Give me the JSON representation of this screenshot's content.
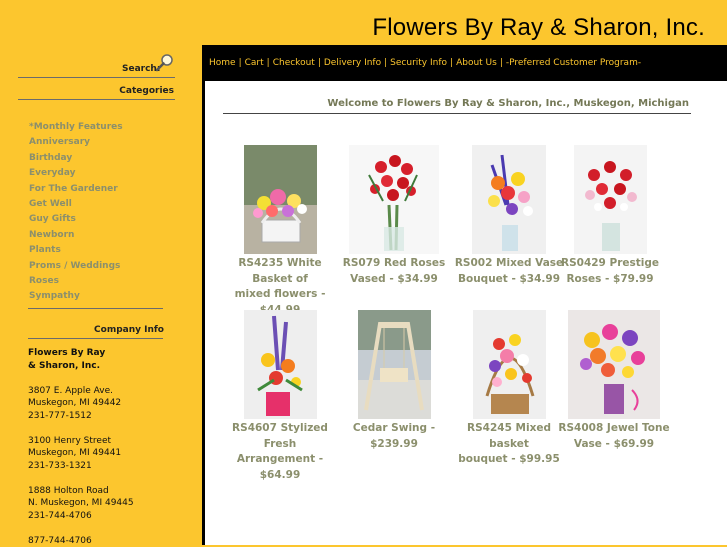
{
  "site": {
    "title": "Flowers By Ray & Sharon, Inc."
  },
  "sidebar": {
    "search_label": "Search:",
    "categories_title": "Categories",
    "categories": [
      "*Monthly Features",
      "Anniversary",
      "Birthday",
      "Everyday",
      "For The Gardener",
      "Get Well",
      "Guy Gifts",
      "Newborn",
      "Plants",
      "Proms / Weddings",
      "Roses",
      "Sympathy"
    ],
    "company_title": "Company Info",
    "company_name_1": "Flowers By Ray",
    "company_name_2": "& Sharon, Inc.",
    "locations": [
      {
        "street": "3807 E. Apple Ave.",
        "city": "Muskegon, MI 49442",
        "phone": "231-777-1512"
      },
      {
        "street": "3100 Henry Street",
        "city": "Muskegon, MI 49441",
        "phone": "231-733-1321"
      },
      {
        "street": "1888 Holton Road",
        "city": "N. Muskegon, MI 49445",
        "phone": "231-744-4706"
      }
    ],
    "extra_phone": "877-744-4706"
  },
  "nav": [
    "Home",
    "Cart",
    "Checkout",
    "Delivery Info",
    "Security Info",
    "About Us",
    "-Preferred Customer Program-"
  ],
  "main": {
    "welcome": "Welcome to Flowers By Ray & Sharon, Inc., Muskegon, Michigan"
  },
  "products": [
    {
      "line1": "RS4235 White Basket of",
      "line2": "mixed flowers - $44.99"
    },
    {
      "line1": "RS079 Red Roses",
      "line2": "Vased - $34.99"
    },
    {
      "line1": "RS002 Mixed Vase",
      "line2": "Bouquet - $34.99"
    },
    {
      "line1": "RS0429 Prestige",
      "line2": "Roses - $79.99"
    },
    {
      "line1": "RS4607 Stylized Fresh",
      "line2": "Arrangement - $64.99"
    },
    {
      "line1": "Cedar Swing -",
      "line2": "$239.99"
    },
    {
      "line1": "RS4245 Mixed basket",
      "line2": "bouquet - $99.95"
    },
    {
      "line1": "RS4008 Jewel Tone",
      "line2": "Vase - $69.99"
    }
  ],
  "colors": {
    "background": "#fcc62e",
    "nav_bg": "#000000",
    "nav_text": "#fcc62e",
    "link": "#8b8f6c",
    "welcome": "#747856"
  }
}
